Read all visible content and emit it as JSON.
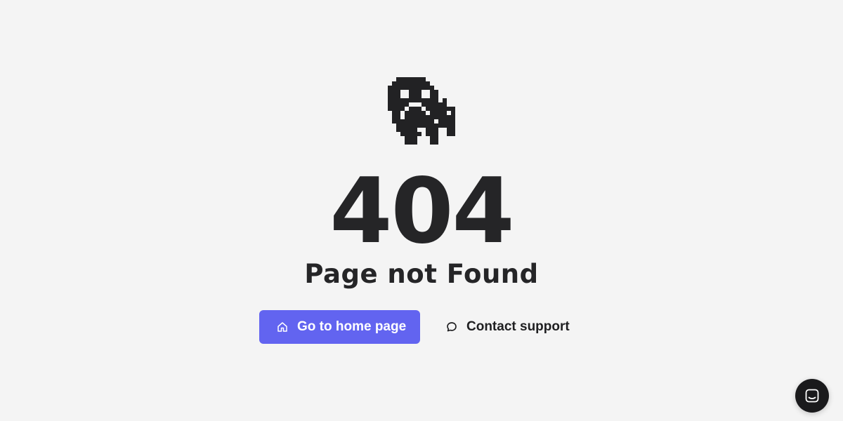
{
  "error": {
    "code": "404",
    "title": "Page not Found",
    "illustration_icon": "pixel-ghost-icon"
  },
  "actions": {
    "home_label": "Go to home page",
    "home_icon": "home-icon",
    "support_label": "Contact support",
    "support_icon": "chat-bubble-icon"
  },
  "chat_widget": {
    "icon": "chat-messenger-icon"
  },
  "colors": {
    "background": "#f4f4f4",
    "text": "#252527",
    "primary": "#6264f0",
    "primary_text": "#ffffff",
    "chat_launcher": "#1a1a1c"
  }
}
